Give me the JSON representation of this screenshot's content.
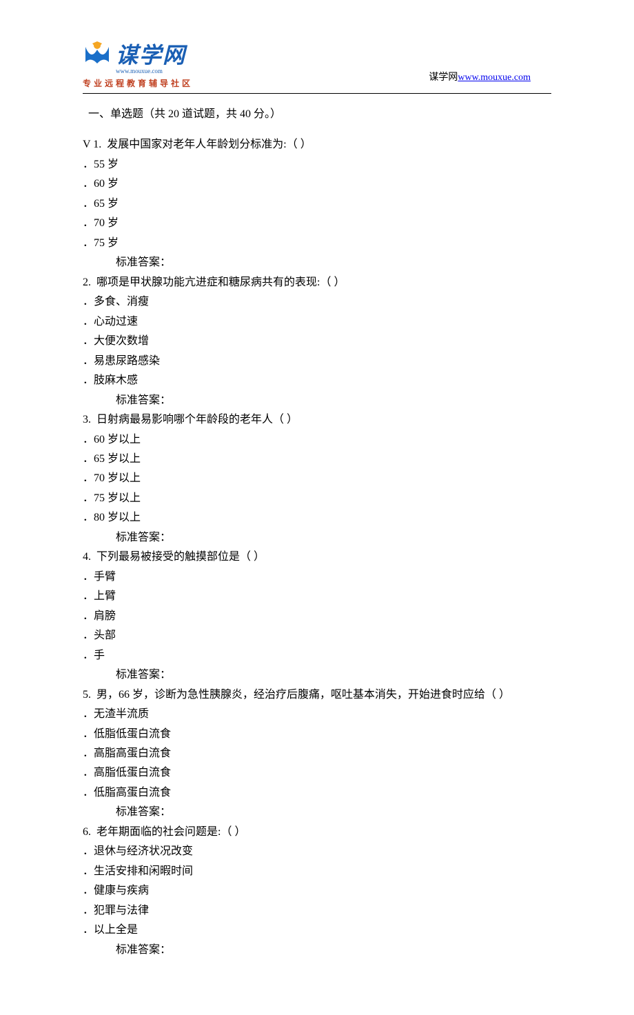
{
  "header": {
    "logo_cn": "谋学网",
    "logo_url_small": "www.mouxue.com",
    "logo_tagline": "专业远程教育辅导社区",
    "right_label": "谋学网",
    "right_link": "www.mouxue.com"
  },
  "section": {
    "title": "一、单选题（共 20 道试题，共 40 分。）"
  },
  "questions": [
    {
      "prefix": "V 1.",
      "stem": "发展中国家对老年人年龄划分标准为:（ ）",
      "options": [
        "．55 岁",
        "．60 岁",
        "．65 岁",
        "．70 岁",
        "．75 岁"
      ],
      "answer_label": "标准答案："
    },
    {
      "prefix": "2.",
      "stem": "哪项是甲状腺功能亢进症和糖尿病共有的表现:（ ）",
      "options": [
        "．多食、消瘦",
        "．心动过速",
        "．大便次数增",
        "．易患尿路感染",
        "．肢麻木感"
      ],
      "answer_label": "标准答案："
    },
    {
      "prefix": "3.",
      "stem": "日射病最易影响哪个年龄段的老年人（ ）",
      "options": [
        "．60 岁以上",
        "．65 岁以上",
        "．70 岁以上",
        "．75 岁以上",
        "．80 岁以上"
      ],
      "answer_label": "标准答案："
    },
    {
      "prefix": "4.",
      "stem": "下列最易被接受的触摸部位是（ ）",
      "options": [
        "．手臂",
        "．上臂",
        "．肩膀",
        "．头部",
        "．手"
      ],
      "answer_label": "标准答案："
    },
    {
      "prefix": "5.",
      "stem": "男，66 岁，诊断为急性胰腺炎，经治疗后腹痛，呕吐基本消失，开始进食时应给（ ）",
      "options": [
        "．无渣半流质",
        "．低脂低蛋白流食",
        "．高脂高蛋白流食",
        "．高脂低蛋白流食",
        "．低脂高蛋白流食"
      ],
      "answer_label": "标准答案："
    },
    {
      "prefix": "6.",
      "stem": "老年期面临的社会问题是:（ ）",
      "options": [
        "．退休与经济状况改变",
        "．生活安排和闲暇时间",
        "．健康与疾病",
        "．犯罪与法律",
        "．以上全是"
      ],
      "answer_label": "标准答案："
    }
  ]
}
